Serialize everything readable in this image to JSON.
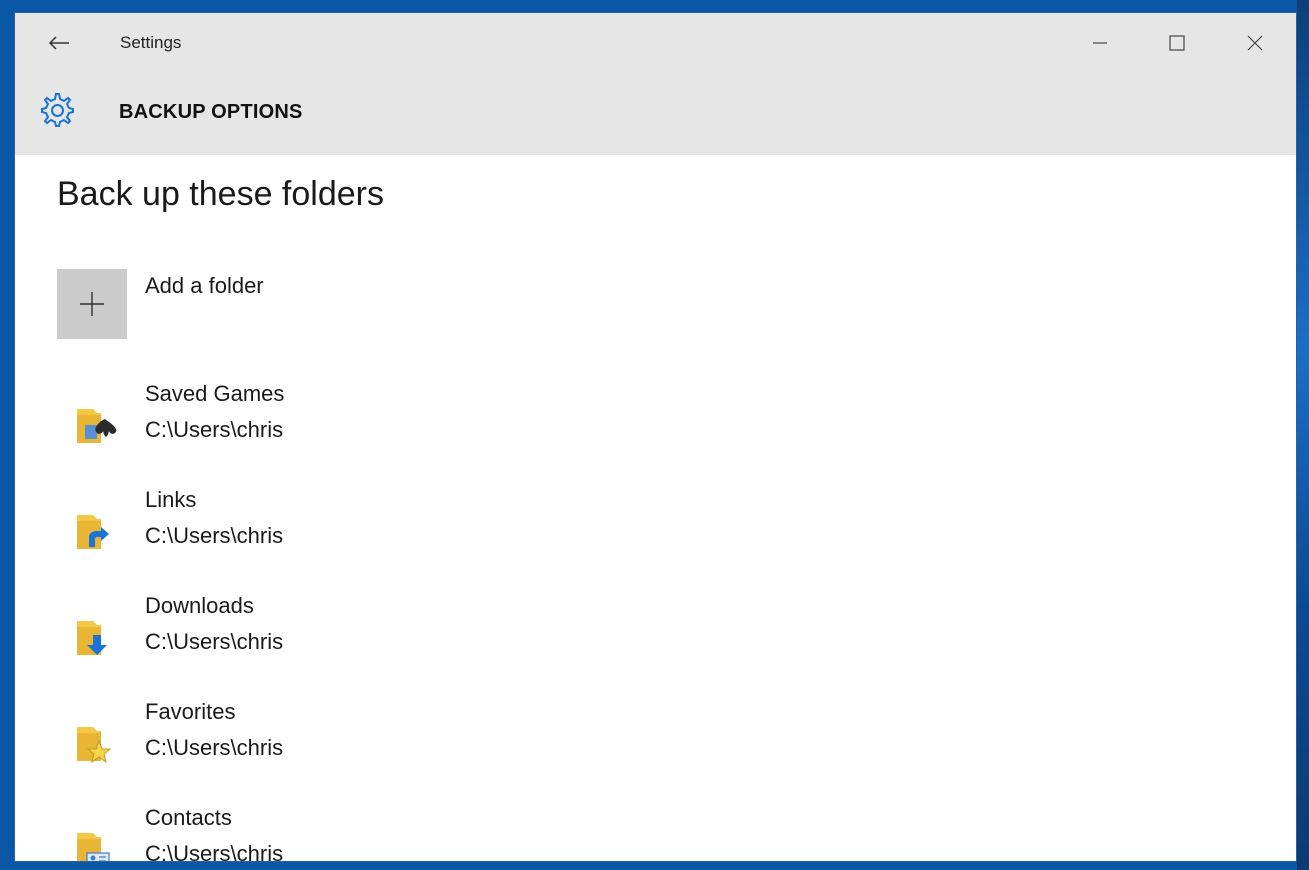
{
  "window": {
    "app_title": "Settings",
    "page_title": "BACKUP OPTIONS"
  },
  "main": {
    "section_title": "Back up these folders",
    "add_folder_label": "Add a folder",
    "folders": [
      {
        "name": "Saved Games",
        "path": "C:\\Users\\chris",
        "icon": "saved-games-folder-icon"
      },
      {
        "name": "Links",
        "path": "C:\\Users\\chris",
        "icon": "links-folder-icon"
      },
      {
        "name": "Downloads",
        "path": "C:\\Users\\chris",
        "icon": "downloads-folder-icon"
      },
      {
        "name": "Favorites",
        "path": "C:\\Users\\chris",
        "icon": "favorites-folder-icon"
      },
      {
        "name": "Contacts",
        "path": "C:\\Users\\chris",
        "icon": "contacts-folder-icon"
      }
    ]
  },
  "colors": {
    "header_bg": "#e6e6e6",
    "accent": "#1a73d6",
    "folder_yellow": "#f3c846"
  }
}
